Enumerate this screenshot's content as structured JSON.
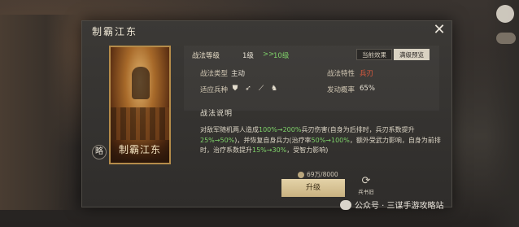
{
  "title": "制霸江东",
  "card_name": "制霸江东",
  "skill_badge": "略",
  "tabs": [
    "当前效果",
    "满级预览"
  ],
  "level": {
    "label": "战法等级",
    "current": "1级",
    "arrow": ">>",
    "max": "10级"
  },
  "stats": {
    "type_label": "战法类型",
    "type_value": "主动",
    "trait_label": "战法特性",
    "trait_value": "兵刃",
    "troops_label": "适应兵种",
    "rate_label": "发动概率",
    "rate_value": "65%"
  },
  "troop_icons": [
    "shield-icon",
    "bow-icon",
    "spear-icon",
    "horse-icon"
  ],
  "section_title": "战法说明",
  "description": {
    "p1": "对敌军随机两人造成",
    "g1": "100%→200%",
    "p2": "兵刃伤害(自身为后排时，兵刃系数提升",
    "g2": "25%→50%",
    "p3": ")，并恢复自身兵力(治疗率",
    "g3": "50%→100%",
    "p4": "，额外受武力影响，自身为前排时，治疗系数提升",
    "g4": "15%→30%",
    "p5": "，受智力影响)"
  },
  "cost": "69万/8000",
  "upgrade_label": "升级",
  "reset_label": "兵书旧",
  "watermark": "公众号 · 三谋手游攻略站",
  "colors": {
    "green": "#7fd26a",
    "red": "#e05a3e"
  }
}
